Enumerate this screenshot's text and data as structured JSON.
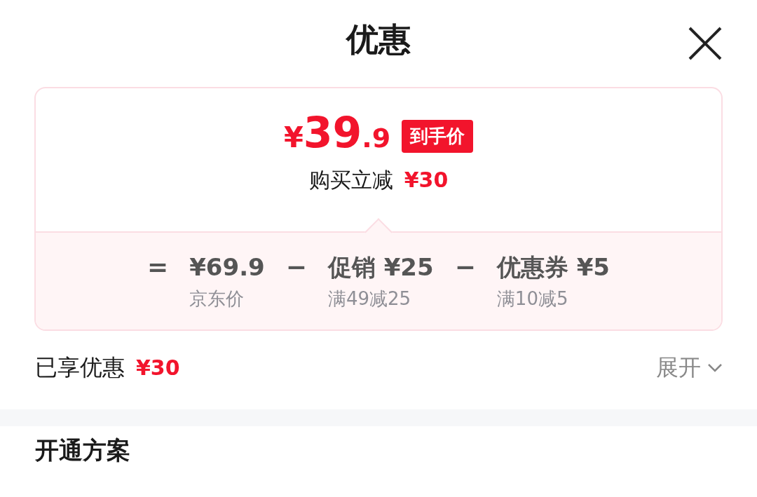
{
  "title": "优惠",
  "price": {
    "currency": "¥",
    "integer": "39",
    "decimal": ".9",
    "tag": "到手价"
  },
  "saving": {
    "label": "购买立减",
    "amount": "¥30"
  },
  "breakdown": [
    {
      "operator": "=",
      "amount": "¥69.9",
      "note": "京东价"
    },
    {
      "operator": "−",
      "amount": "促销 ¥25",
      "note": "满49减25"
    },
    {
      "operator": "−",
      "amount": "优惠券 ¥5",
      "note": "满10减5"
    }
  ],
  "enjoyed": {
    "label": "已享优惠",
    "amount": "¥30"
  },
  "expand": {
    "label": "展开",
    "expanded": false
  },
  "section_title": "开通方案"
}
